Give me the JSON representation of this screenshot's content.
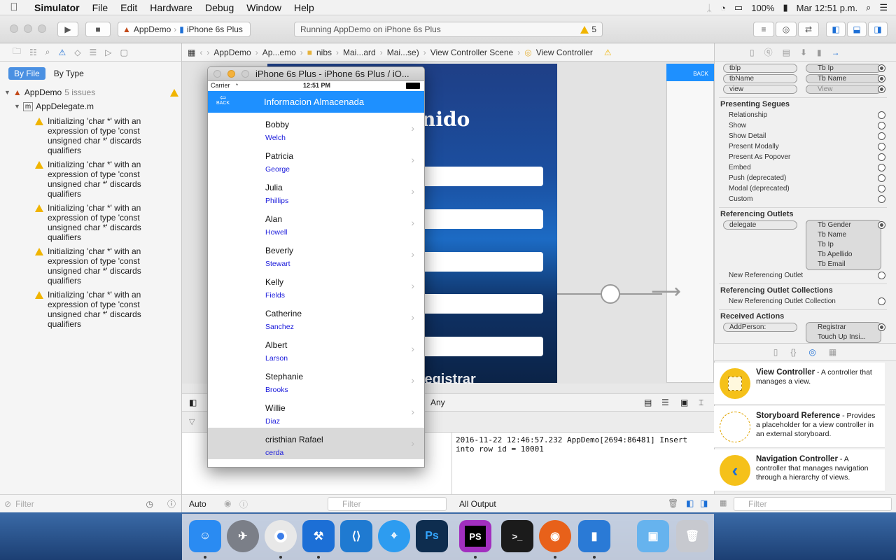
{
  "menubar": {
    "app": "Simulator",
    "items": [
      "File",
      "Edit",
      "Hardware",
      "Debug",
      "Window",
      "Help"
    ],
    "battery": "100%",
    "clock": "Mar 12:51 p.m."
  },
  "toolbar": {
    "scheme_target": "AppDemo",
    "scheme_device": "iPhone 6s Plus",
    "activity_text": "Running AppDemo on iPhone 6s Plus",
    "warning_count": "5"
  },
  "navigator": {
    "seg_by_file": "By File",
    "seg_by_type": "By Type",
    "project": "AppDemo",
    "project_issues": "5 issues",
    "file": "AppDelegate.m",
    "issues": [
      "Initializing 'char *' with an expression of type 'const unsigned char *' discards qualifiers",
      "Initializing 'char *' with an expression of type 'const unsigned char *' discards qualifiers",
      "Initializing 'char *' with an expression of type 'const unsigned char *' discards qualifiers",
      "Initializing 'char *' with an expression of type 'const unsigned char *' discards qualifiers",
      "Initializing 'char *' with an expression of type 'const unsigned char *' discards qualifiers"
    ],
    "filter_placeholder": "Filter"
  },
  "jumpbar": [
    "AppDemo",
    "Ap...emo",
    "nibs",
    "Mai...ard",
    "Mai...se)",
    "View Controller Scene",
    "View Controller"
  ],
  "canvas": {
    "scene_title": "nido",
    "scene_bottom": "Registrar",
    "scene2_back": "BACK",
    "size_class": "Any"
  },
  "console": {
    "line": "2016-11-22 12:46:57.232 AppDemo[2694:86481] Insert into row id = 10001",
    "output_selector": "All Output",
    "auto_selector": "Auto",
    "filter_placeholder": "Filter"
  },
  "inspector": {
    "top_outlets": [
      {
        "from": "tblp",
        "to": "Tb Ip"
      },
      {
        "from": "tbName",
        "to": "Tb Name"
      },
      {
        "from": "view",
        "to": "View"
      }
    ],
    "presenting_title": "Presenting Segues",
    "presenting": [
      "Relationship",
      "Show",
      "Show Detail",
      "Present Modally",
      "Present As Popover",
      "Embed",
      "Push (deprecated)",
      "Modal (deprecated)",
      "Custom"
    ],
    "ref_outlets_title": "Referencing Outlets",
    "ref_outlet_from": "delegate",
    "ref_outlet_targets": [
      "Tb Gender",
      "Tb Name",
      "Tb Ip",
      "Tb Apellido",
      "Tb Email"
    ],
    "new_ref_outlet": "New Referencing Outlet",
    "ref_collections_title": "Referencing Outlet Collections",
    "new_ref_collection": "New Referencing Outlet Collection",
    "received_title": "Received Actions",
    "action_from": "AddPerson:",
    "action_to_1": "Registrar",
    "action_to_2": "Touch Up Insi..."
  },
  "library": [
    {
      "title": "View Controller",
      "desc": " - A controller that manages a view."
    },
    {
      "title": "Storyboard Reference",
      "desc": " - Provides a placeholder for a view controller in an external storyboard."
    },
    {
      "title": "Navigation Controller",
      "desc": " - A controller that manages navigation through a hierarchy of views."
    }
  ],
  "library_filter": "Filter",
  "simulator": {
    "window_title": "iPhone 6s Plus - iPhone 6s Plus / iO...",
    "carrier": "Carrier",
    "time": "12:51 PM",
    "nav_title": "Informacion Almacenada",
    "back_label": "BACK",
    "rows": [
      {
        "first": "Bobby",
        "last": "Welch"
      },
      {
        "first": "Patricia",
        "last": "George"
      },
      {
        "first": "Julia",
        "last": "Phillips"
      },
      {
        "first": "Alan",
        "last": "Howell"
      },
      {
        "first": "Beverly",
        "last": "Stewart"
      },
      {
        "first": "Kelly",
        "last": "Fields"
      },
      {
        "first": "Catherine",
        "last": "Sanchez"
      },
      {
        "first": "Albert",
        "last": "Larson"
      },
      {
        "first": "Stephanie",
        "last": "Brooks"
      },
      {
        "first": "Willie",
        "last": "Diaz"
      },
      {
        "first": "cristhian Rafael",
        "last": "cerda"
      }
    ]
  },
  "dock": [
    {
      "name": "finder-icon",
      "color": "#2a8bf2"
    },
    {
      "name": "launchpad-icon",
      "color": "#7b7f88"
    },
    {
      "name": "chrome-icon",
      "color": "#e8e8e8"
    },
    {
      "name": "xcode-icon",
      "color": "#1c6fd6"
    },
    {
      "name": "vscode-icon",
      "color": "#1f7ad1"
    },
    {
      "name": "safari-icon",
      "color": "#2d9cf0"
    },
    {
      "name": "photoshop-icon",
      "color": "#0e2d4f"
    },
    {
      "name": "phpstorm-icon",
      "color": "#a22fbf"
    },
    {
      "name": "terminal-icon",
      "color": "#1b1b1b"
    },
    {
      "name": "firefox-icon",
      "color": "#e8611a"
    },
    {
      "name": "simulator-icon",
      "color": "#2a7ad6"
    },
    {
      "name": "downloads-folder-icon",
      "color": "#66b3ee"
    },
    {
      "name": "trash-icon",
      "color": "#c7c9cf"
    }
  ],
  "dock_labels": {
    "photoshop": "Ps",
    "phpstorm": "PS",
    "terminal": ">_"
  }
}
